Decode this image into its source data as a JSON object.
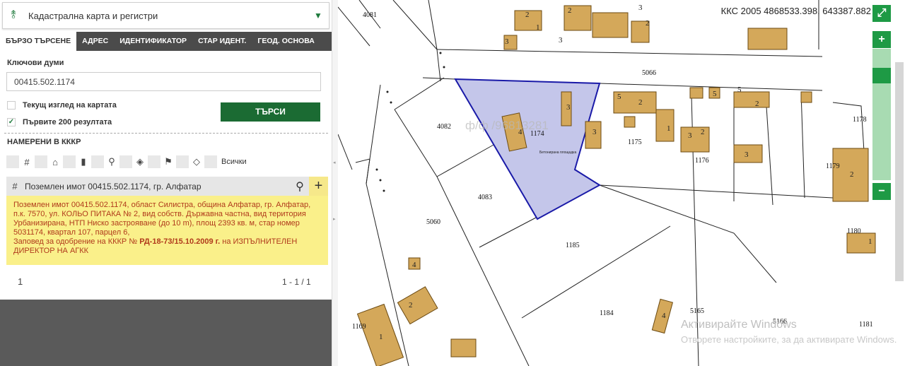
{
  "panel": {
    "layer_title": "Кадастрална карта и регистри",
    "tabs": [
      {
        "label": "БЪРЗО ТЪРСЕНЕ",
        "active": true
      },
      {
        "label": "АДРЕС",
        "active": false
      },
      {
        "label": "ИДЕНТИФИКАТОР",
        "active": false
      },
      {
        "label": "СТАР ИДЕНТ.",
        "active": false
      },
      {
        "label": "ГЕОД. ОСНОВА",
        "active": false
      }
    ],
    "keywords_label": "Ключови думи",
    "keywords_value": "00415.502.1174",
    "checkbox_current_view": {
      "label": "Текущ изглед на картата",
      "checked": false
    },
    "checkbox_first_200": {
      "label": "Първите 200 резултата",
      "checked": true
    },
    "search_button": "ТЪРСИ",
    "found_label": "НАМЕРЕНИ В КККР",
    "filter_all_label": "Всички",
    "result": {
      "title": "Поземлен имот 00415.502.1174, гр. Алфатар",
      "desc_pre": "Поземлен имот 00415.502.1174, област Силистра, община Алфатар, гр. Алфатар, п.к. 7570, ул. КОЛЬО ПИТАКА № 2, вид собств. Държавна частна, вид територия Урбанизирана, НТП Ниско застрояване (до 10 m), площ 2393 кв. м, стар номер 5031174, квартал 107, парцел 6,",
      "desc_order_pre": "Заповед за одобрение на КККР №",
      "desc_order_num": "РД-18-73/15.10.2009 г.",
      "desc_order_post": "на ИЗПЪЛНИТЕЛЕН ДИРЕКТОР НА АГКК"
    },
    "pager_page": "1",
    "pager_range": "1 - 1 / 1"
  },
  "map": {
    "coordinates": "ККС 2005 4868533.398, 643387.882",
    "expand_icon": "expand-icon",
    "zoom_in": "+",
    "zoom_out": "−",
    "parcel_labels": [
      "4081",
      "5066",
      "4082",
      "1174",
      "1175",
      "1176",
      "1178",
      "1179",
      "4083",
      "5060",
      "1180",
      "1185",
      "1184",
      "5165",
      "5166",
      "1181",
      "1169"
    ],
    "building_numbers": [
      "2",
      "1",
      "3",
      "5",
      "4"
    ],
    "highlight_overlay_text": "Бетонирана площадка",
    "watermark_text": "ф/ф /96813281",
    "windows_watermark_title": "Активирайте Windows",
    "windows_watermark_sub": "Отворете настройките, за да активирате Windows.",
    "colors": {
      "highlight_fill": "#c4c6ea",
      "highlight_stroke": "#1a1aa8",
      "building_fill": "#d4a85a",
      "accent_green": "#1b6b33"
    }
  }
}
